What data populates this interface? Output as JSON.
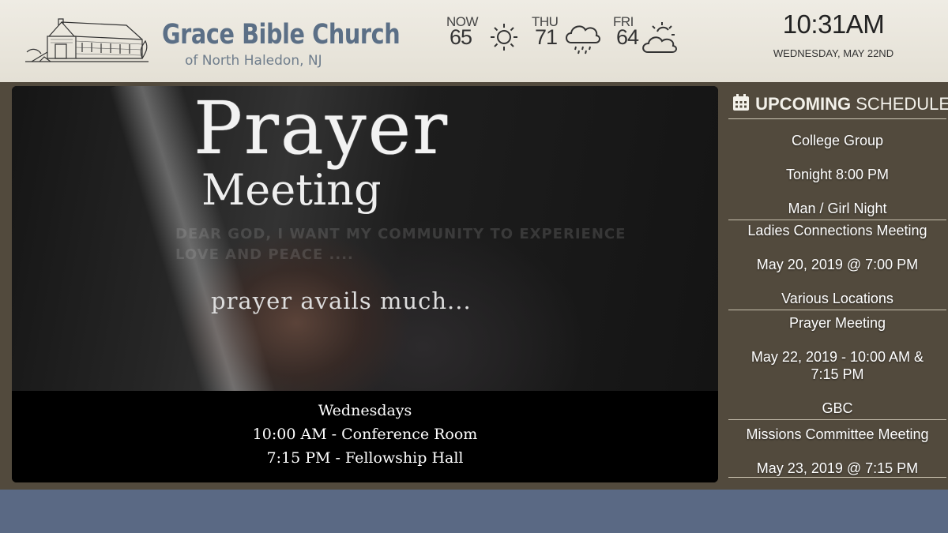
{
  "header": {
    "church_name": "Grace Bible Church",
    "church_location": "of North Haledon, NJ"
  },
  "weather": [
    {
      "label": "NOW",
      "temp": "65",
      "icon": "sun-icon"
    },
    {
      "label": "THU",
      "temp": "71",
      "icon": "rain-cloud-icon"
    },
    {
      "label": "FRI",
      "temp": "64",
      "icon": "partly-cloudy-icon"
    }
  ],
  "clock": {
    "time": "10:31AM",
    "date": "WEDNESDAY, MAY 22ND"
  },
  "slide": {
    "title": "Prayer",
    "subtitle": "Meeting",
    "faded_text": "DEAR GOD, I WANT MY COMMUNITY TO EXPERIENCE LOVE AND PEACE ....",
    "tagline": "prayer avails much...",
    "caption_line1": "Wednesdays",
    "caption_line2": "10:00 AM - Conference Room",
    "caption_line3": "7:15 PM - Fellowship Hall"
  },
  "schedule": {
    "heading_bold": "UPCOMING",
    "heading_rest": "SCHEDULE",
    "items": [
      {
        "name": "College Group",
        "when": "Tonight 8:00 PM",
        "location": "Man / Girl Night"
      },
      {
        "name": "Ladies Connections Meeting",
        "when": "May 20, 2019 @ 7:00 PM",
        "location": "Various Locations"
      },
      {
        "name": "Prayer Meeting",
        "when": "May 22, 2019 - 10:00 AM & 7:15 PM",
        "location": "GBC"
      },
      {
        "name": "Missions Committee Meeting",
        "when": "May 23, 2019 @ 7:15 PM",
        "location": ""
      }
    ]
  },
  "colors": {
    "header_bg": "#e9e6dd",
    "band_bg": "#524a3d",
    "footer_bg": "#5a6984",
    "church_name": "#5b6f86"
  }
}
